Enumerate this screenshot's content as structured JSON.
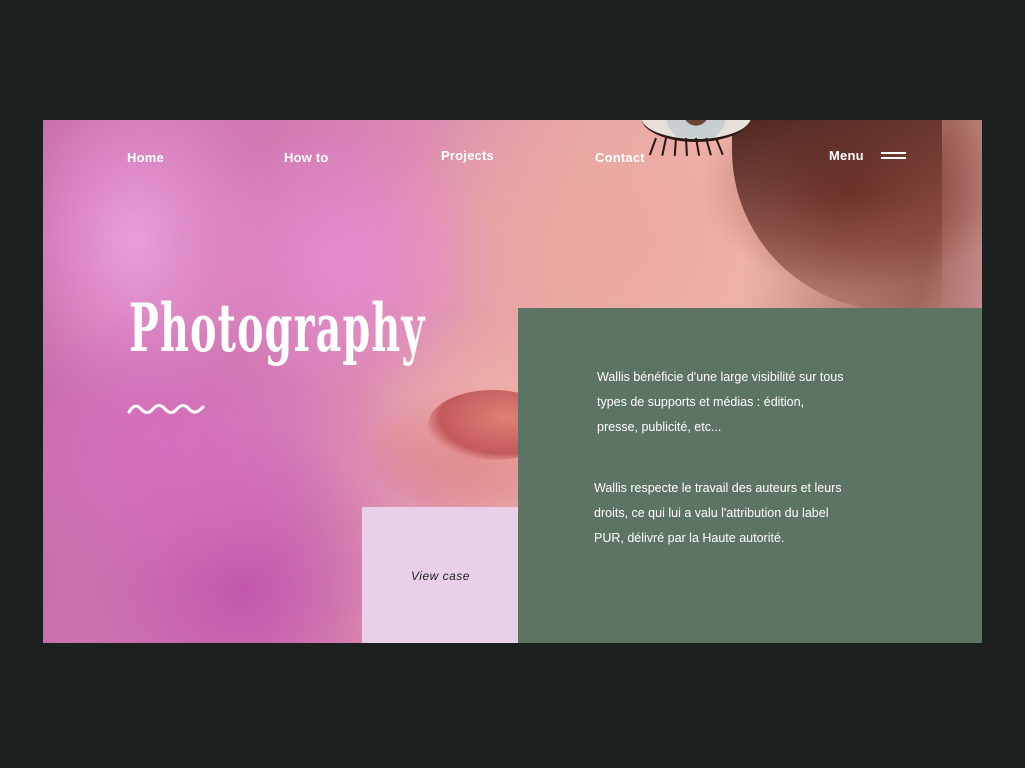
{
  "nav": {
    "home": "Home",
    "how_to": "How to",
    "projects": "Projects",
    "contact": "Contact",
    "menu": "Menu"
  },
  "hero": {
    "title": "Photography"
  },
  "view_case": {
    "label": "View case"
  },
  "info": {
    "paragraph_1": "Wallis bénéficie d'une large visibilité sur tous types de supports et médias : édition, presse, publicité, etc...",
    "paragraph_2": "Wallis respecte le travail des auteurs et leurs droits, ce qui lui a valu l'attribution du label PUR, délivré par la Haute autorité."
  },
  "colors": {
    "background": "#1c211f",
    "info_panel": "#5d7465",
    "view_case_panel": "#e9cfe8",
    "text_light": "#ffffff"
  },
  "icons": {
    "menu": "hamburger-icon",
    "decoration": "wave-icon"
  }
}
